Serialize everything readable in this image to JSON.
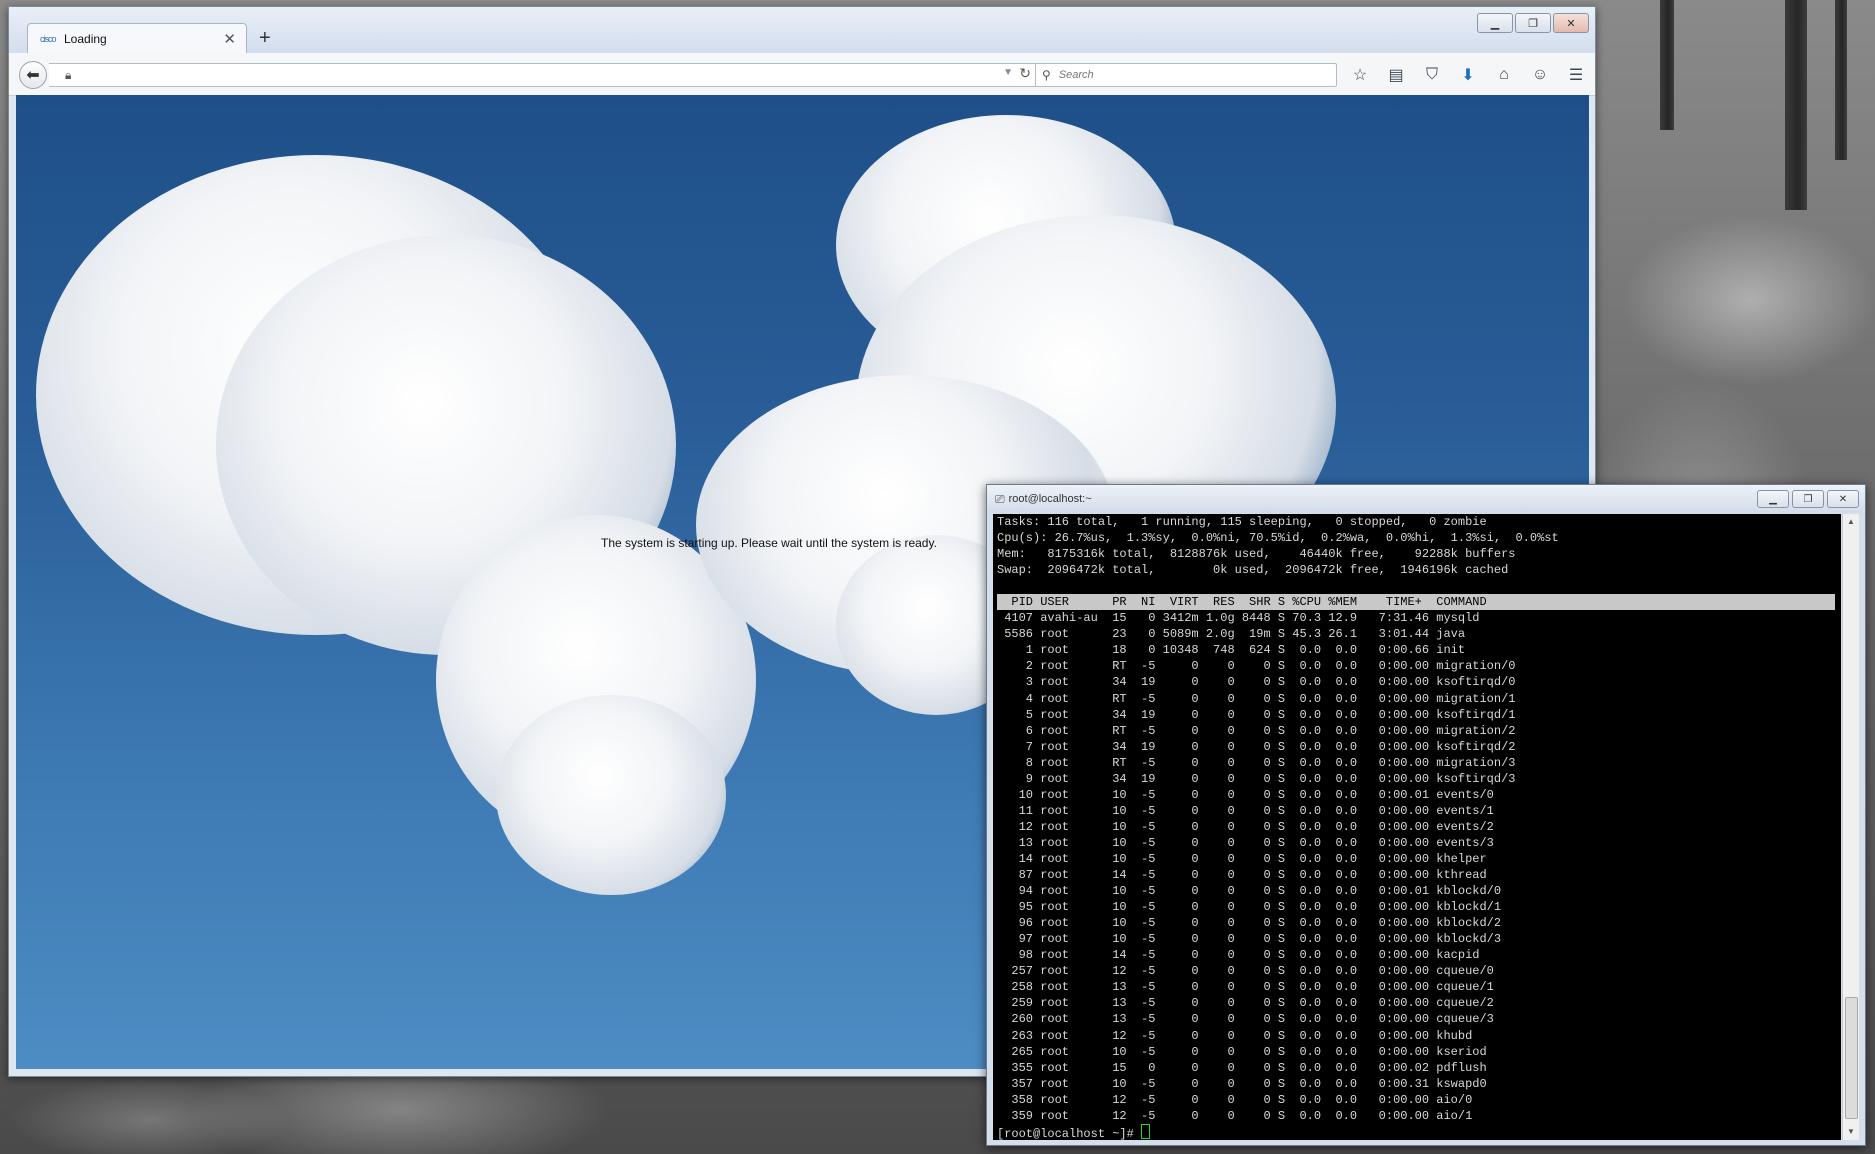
{
  "browser": {
    "tab_title": "Loading",
    "tab_favicon_text": "cisco",
    "tab_close": "✕",
    "new_tab": "+",
    "url": "",
    "search_placeholder": "Search",
    "status_message": "The system is starting up. Please wait until the system is ready.",
    "toolbar_icons": [
      "star-icon",
      "reading-list-icon",
      "pocket-icon",
      "download-icon",
      "home-icon",
      "chat-icon",
      "menu-icon"
    ]
  },
  "terminal": {
    "title": "root@localhost:~",
    "summary": [
      "Tasks: 116 total,   1 running, 115 sleeping,   0 stopped,   0 zombie",
      "Cpu(s): 26.7%us,  1.3%sy,  0.0%ni, 70.5%id,  0.2%wa,  0.0%hi,  1.3%si,  0.0%st",
      "Mem:   8175316k total,  8128876k used,    46440k free,    92288k buffers",
      "Swap:  2096472k total,        0k used,  2096472k free,  1946196k cached",
      ""
    ],
    "header": "  PID USER      PR  NI  VIRT  RES  SHR S %CPU %MEM    TIME+  COMMAND",
    "processes": [
      " 4107 avahi-au  15   0 3412m 1.0g 8448 S 70.3 12.9   7:31.46 mysqld",
      " 5586 root      23   0 5089m 2.0g  19m S 45.3 26.1   3:01.44 java",
      "    1 root      18   0 10348  748  624 S  0.0  0.0   0:00.66 init",
      "    2 root      RT  -5     0    0    0 S  0.0  0.0   0:00.00 migration/0",
      "    3 root      34  19     0    0    0 S  0.0  0.0   0:00.00 ksoftirqd/0",
      "    4 root      RT  -5     0    0    0 S  0.0  0.0   0:00.00 migration/1",
      "    5 root      34  19     0    0    0 S  0.0  0.0   0:00.00 ksoftirqd/1",
      "    6 root      RT  -5     0    0    0 S  0.0  0.0   0:00.00 migration/2",
      "    7 root      34  19     0    0    0 S  0.0  0.0   0:00.00 ksoftirqd/2",
      "    8 root      RT  -5     0    0    0 S  0.0  0.0   0:00.00 migration/3",
      "    9 root      34  19     0    0    0 S  0.0  0.0   0:00.00 ksoftirqd/3",
      "   10 root      10  -5     0    0    0 S  0.0  0.0   0:00.01 events/0",
      "   11 root      10  -5     0    0    0 S  0.0  0.0   0:00.00 events/1",
      "   12 root      10  -5     0    0    0 S  0.0  0.0   0:00.00 events/2",
      "   13 root      10  -5     0    0    0 S  0.0  0.0   0:00.00 events/3",
      "   14 root      10  -5     0    0    0 S  0.0  0.0   0:00.00 khelper",
      "   87 root      14  -5     0    0    0 S  0.0  0.0   0:00.00 kthread",
      "   94 root      10  -5     0    0    0 S  0.0  0.0   0:00.01 kblockd/0",
      "   95 root      10  -5     0    0    0 S  0.0  0.0   0:00.00 kblockd/1",
      "   96 root      10  -5     0    0    0 S  0.0  0.0   0:00.00 kblockd/2",
      "   97 root      10  -5     0    0    0 S  0.0  0.0   0:00.00 kblockd/3",
      "   98 root      14  -5     0    0    0 S  0.0  0.0   0:00.00 kacpid",
      "  257 root      12  -5     0    0    0 S  0.0  0.0   0:00.00 cqueue/0",
      "  258 root      13  -5     0    0    0 S  0.0  0.0   0:00.00 cqueue/1",
      "  259 root      13  -5     0    0    0 S  0.0  0.0   0:00.00 cqueue/2",
      "  260 root      13  -5     0    0    0 S  0.0  0.0   0:00.00 cqueue/3",
      "  263 root      12  -5     0    0    0 S  0.0  0.0   0:00.00 khubd",
      "  265 root      10  -5     0    0    0 S  0.0  0.0   0:00.00 kseriod",
      "  355 root      15   0     0    0    0 S  0.0  0.0   0:00.02 pdflush",
      "  357 root      10  -5     0    0    0 S  0.0  0.0   0:00.31 kswapd0",
      "  358 root      12  -5     0    0    0 S  0.0  0.0   0:00.00 aio/0",
      "  359 root      12  -5     0    0    0 S  0.0  0.0   0:00.00 aio/1"
    ],
    "prompt": "[root@localhost ~]# "
  }
}
